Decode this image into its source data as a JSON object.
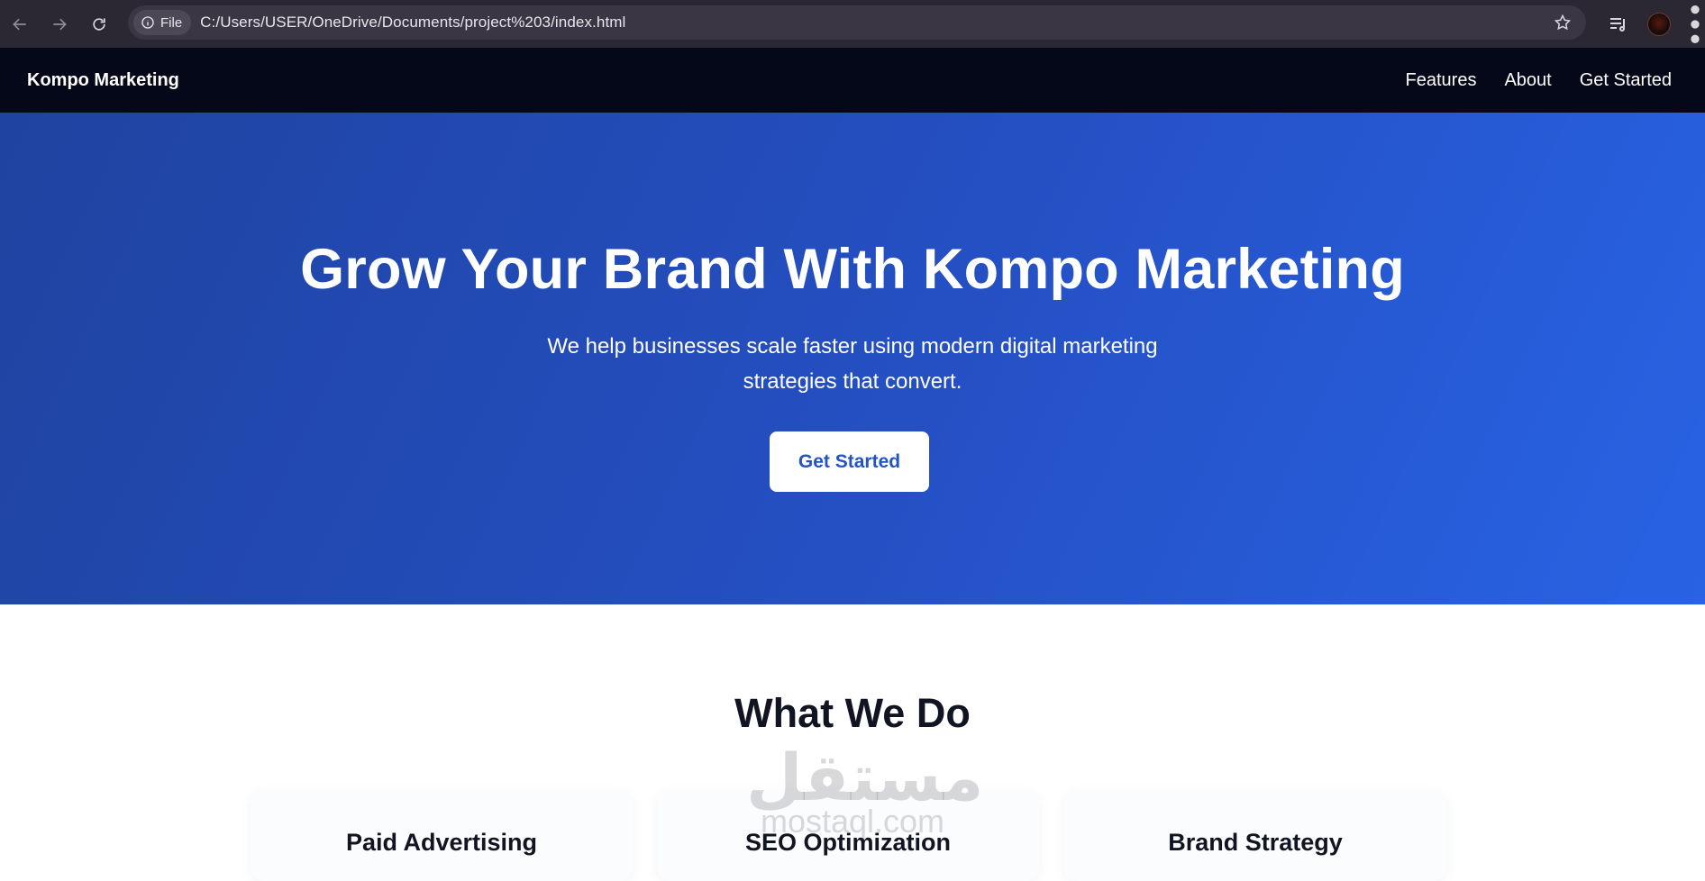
{
  "browser": {
    "site_chip": "File",
    "url": "C:/Users/USER/OneDrive/Documents/project%203/index.html"
  },
  "navbar": {
    "brand": "Kompo Marketing",
    "links": [
      "Features",
      "About",
      "Get Started"
    ]
  },
  "hero": {
    "title": "Grow Your Brand With Kompo Marketing",
    "subtitle": "We help businesses scale faster using modern digital marketing strategies that convert.",
    "cta": "Get Started"
  },
  "services": {
    "title": "What We Do",
    "cards": [
      "Paid Advertising",
      "SEO Optimization",
      "Brand Strategy"
    ]
  },
  "watermark": {
    "arabic": "مستقل",
    "latin": "mostaql.com"
  },
  "colors": {
    "chrome_bg": "#2b2834",
    "navbar_bg": "#050818",
    "hero_start": "#1f43a0",
    "hero_end": "#2863e4",
    "cta_text": "#2454c2"
  },
  "icons": [
    "back-arrow-icon",
    "forward-arrow-icon",
    "reload-icon",
    "info-icon",
    "star-icon",
    "reading-list-icon",
    "profile-avatar",
    "kebab-menu-icon"
  ]
}
